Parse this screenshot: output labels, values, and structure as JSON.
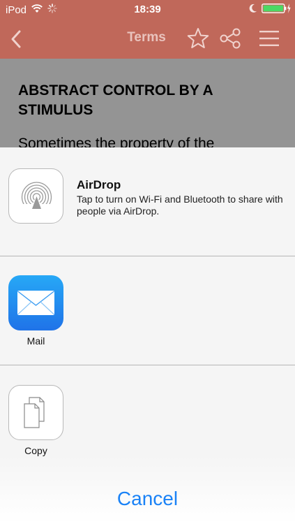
{
  "status_bar": {
    "carrier": "iPod",
    "time": "18:39",
    "icons": [
      "wifi-icon",
      "activity-spinner-icon",
      "moon-icon",
      "battery-charging-icon"
    ]
  },
  "nav": {
    "title": "Terms",
    "icons": [
      "back-chevron-icon",
      "star-icon",
      "share-icon",
      "menu-icon"
    ]
  },
  "article": {
    "heading": "ABSTRACT CONTROL BY A STIMULUS",
    "body": "Sometimes the property of the"
  },
  "share_sheet": {
    "airdrop": {
      "title": "AirDrop",
      "description": "Tap to turn on Wi-Fi and Bluetooth to share with people via AirDrop."
    },
    "apps": [
      {
        "label": "Mail",
        "icon": "mail-icon"
      }
    ],
    "actions": [
      {
        "label": "Copy",
        "icon": "copy-icon"
      }
    ],
    "cancel_label": "Cancel"
  },
  "colors": {
    "nav_background": "#c0685a",
    "nav_title": "#e9c3bd",
    "accent_blue": "#1a82f6",
    "mail_gradient_top": "#27a8f6",
    "mail_gradient_bottom": "#1f73e8"
  }
}
